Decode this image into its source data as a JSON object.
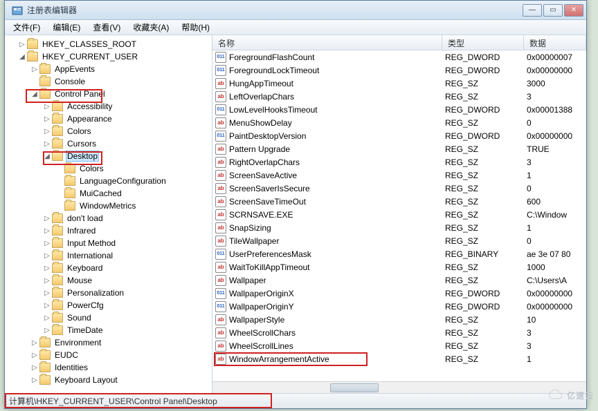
{
  "title": "注册表编辑器",
  "menus": [
    "文件(F)",
    "编辑(E)",
    "查看(V)",
    "收藏夹(A)",
    "帮助(H)"
  ],
  "columns": {
    "name": "名称",
    "type": "类型",
    "data": "数据"
  },
  "statusPath": "计算机\\HKEY_CURRENT_USER\\Control Panel\\Desktop",
  "watermark": "亿速云",
  "tree": [
    {
      "depth": 1,
      "exp": "▷",
      "label": "HKEY_CLASSES_ROOT"
    },
    {
      "depth": 1,
      "exp": "◢",
      "label": "HKEY_CURRENT_USER"
    },
    {
      "depth": 2,
      "exp": "▷",
      "label": "AppEvents"
    },
    {
      "depth": 2,
      "exp": "",
      "label": "Console"
    },
    {
      "depth": 2,
      "exp": "◢",
      "label": "Control Panel",
      "hl": "cp"
    },
    {
      "depth": 3,
      "exp": "▷",
      "label": "Accessibility"
    },
    {
      "depth": 3,
      "exp": "▷",
      "label": "Appearance"
    },
    {
      "depth": 3,
      "exp": "▷",
      "label": "Colors"
    },
    {
      "depth": 3,
      "exp": "▷",
      "label": "Cursors"
    },
    {
      "depth": 3,
      "exp": "◢",
      "label": "Desktop",
      "hl": "dk",
      "sel": true
    },
    {
      "depth": 4,
      "exp": "",
      "label": "Colors"
    },
    {
      "depth": 4,
      "exp": "",
      "label": "LanguageConfiguration"
    },
    {
      "depth": 4,
      "exp": "",
      "label": "MuiCached"
    },
    {
      "depth": 4,
      "exp": "",
      "label": "WindowMetrics"
    },
    {
      "depth": 3,
      "exp": "▷",
      "label": "don't load"
    },
    {
      "depth": 3,
      "exp": "▷",
      "label": "Infrared"
    },
    {
      "depth": 3,
      "exp": "▷",
      "label": "Input Method"
    },
    {
      "depth": 3,
      "exp": "▷",
      "label": "International"
    },
    {
      "depth": 3,
      "exp": "▷",
      "label": "Keyboard"
    },
    {
      "depth": 3,
      "exp": "▷",
      "label": "Mouse"
    },
    {
      "depth": 3,
      "exp": "▷",
      "label": "Personalization"
    },
    {
      "depth": 3,
      "exp": "▷",
      "label": "PowerCfg"
    },
    {
      "depth": 3,
      "exp": "▷",
      "label": "Sound"
    },
    {
      "depth": 3,
      "exp": "▷",
      "label": "TimeDate"
    },
    {
      "depth": 2,
      "exp": "▷",
      "label": "Environment"
    },
    {
      "depth": 2,
      "exp": "▷",
      "label": "EUDC"
    },
    {
      "depth": 2,
      "exp": "▷",
      "label": "Identities"
    },
    {
      "depth": 2,
      "exp": "▷",
      "label": "Keyboard Layout"
    }
  ],
  "values": [
    {
      "name": "ForegroundFlashCount",
      "type": "REG_DWORD",
      "data": "0x00000007",
      "icon": "bin"
    },
    {
      "name": "ForegroundLockTimeout",
      "type": "REG_DWORD",
      "data": "0x00000000",
      "icon": "bin"
    },
    {
      "name": "HungAppTimeout",
      "type": "REG_SZ",
      "data": "3000",
      "icon": "sz"
    },
    {
      "name": "LeftOverlapChars",
      "type": "REG_SZ",
      "data": "3",
      "icon": "sz"
    },
    {
      "name": "LowLevelHooksTimeout",
      "type": "REG_DWORD",
      "data": "0x00001388",
      "icon": "bin"
    },
    {
      "name": "MenuShowDelay",
      "type": "REG_SZ",
      "data": "0",
      "icon": "sz"
    },
    {
      "name": "PaintDesktopVersion",
      "type": "REG_DWORD",
      "data": "0x00000000",
      "icon": "bin"
    },
    {
      "name": "Pattern Upgrade",
      "type": "REG_SZ",
      "data": "TRUE",
      "icon": "sz"
    },
    {
      "name": "RightOverlapChars",
      "type": "REG_SZ",
      "data": "3",
      "icon": "sz"
    },
    {
      "name": "ScreenSaveActive",
      "type": "REG_SZ",
      "data": "1",
      "icon": "sz"
    },
    {
      "name": "ScreenSaverIsSecure",
      "type": "REG_SZ",
      "data": "0",
      "icon": "sz"
    },
    {
      "name": "ScreenSaveTimeOut",
      "type": "REG_SZ",
      "data": "600",
      "icon": "sz"
    },
    {
      "name": "SCRNSAVE.EXE",
      "type": "REG_SZ",
      "data": "C:\\Window",
      "icon": "sz"
    },
    {
      "name": "SnapSizing",
      "type": "REG_SZ",
      "data": "1",
      "icon": "sz"
    },
    {
      "name": "TileWallpaper",
      "type": "REG_SZ",
      "data": "0",
      "icon": "sz"
    },
    {
      "name": "UserPreferencesMask",
      "type": "REG_BINARY",
      "data": "ae 3e 07 80",
      "icon": "bin"
    },
    {
      "name": "WaitToKillAppTimeout",
      "type": "REG_SZ",
      "data": "1000",
      "icon": "sz"
    },
    {
      "name": "Wallpaper",
      "type": "REG_SZ",
      "data": "C:\\Users\\A",
      "icon": "sz"
    },
    {
      "name": "WallpaperOriginX",
      "type": "REG_DWORD",
      "data": "0x00000000",
      "icon": "bin"
    },
    {
      "name": "WallpaperOriginY",
      "type": "REG_DWORD",
      "data": "0x00000000",
      "icon": "bin"
    },
    {
      "name": "WallpaperStyle",
      "type": "REG_SZ",
      "data": "10",
      "icon": "sz"
    },
    {
      "name": "WheelScrollChars",
      "type": "REG_SZ",
      "data": "3",
      "icon": "sz"
    },
    {
      "name": "WheelScrollLines",
      "type": "REG_SZ",
      "data": "3",
      "icon": "sz"
    },
    {
      "name": "WindowArrangementActive",
      "type": "REG_SZ",
      "data": "1",
      "icon": "sz",
      "hl": true
    }
  ]
}
